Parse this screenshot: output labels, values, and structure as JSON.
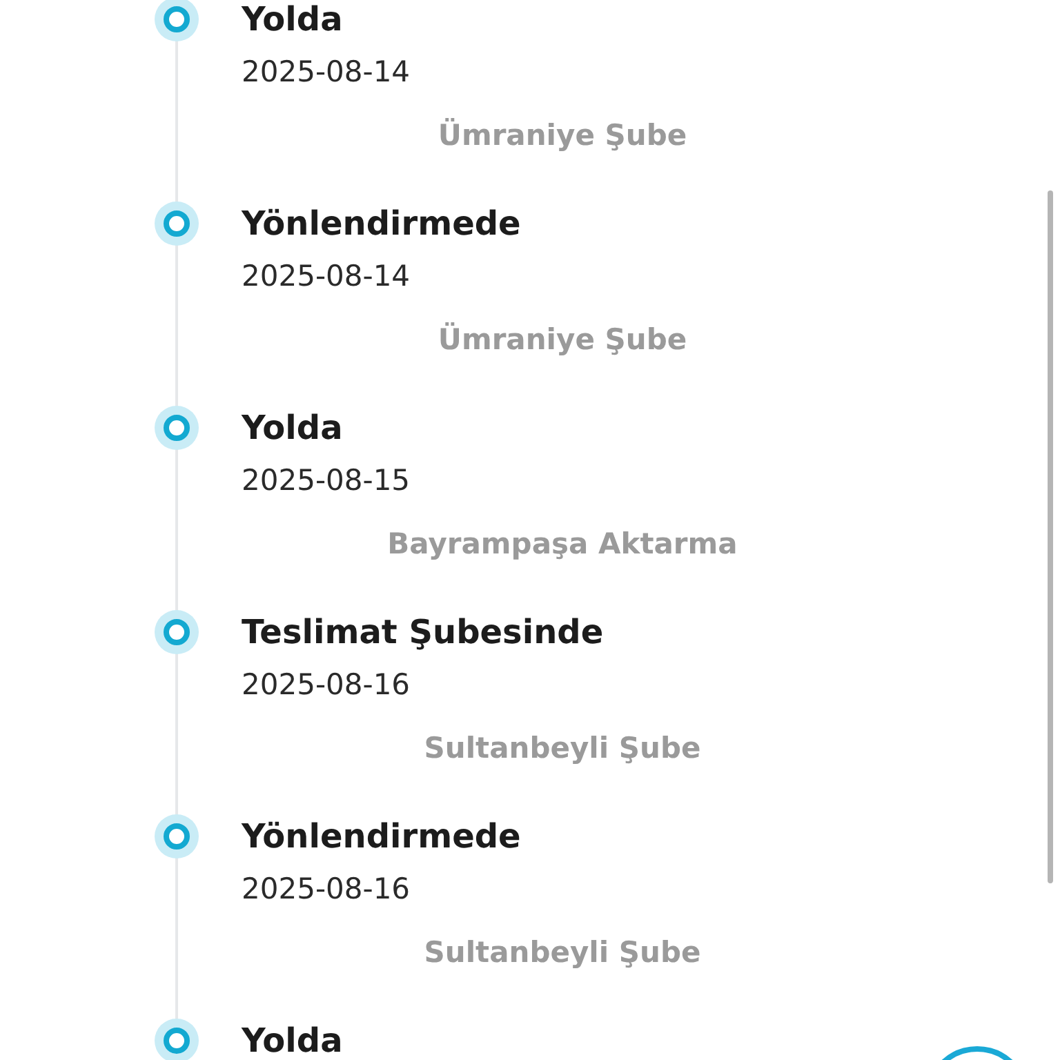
{
  "timeline": [
    {
      "status": "Yolda",
      "date": "2025-08-14",
      "location": "Ümraniye Şube"
    },
    {
      "status": "Yönlendirmede",
      "date": "2025-08-14",
      "location": "Ümraniye Şube"
    },
    {
      "status": "Yolda",
      "date": "2025-08-15",
      "location": "Bayrampaşa Aktarma"
    },
    {
      "status": "Teslimat Şubesinde",
      "date": "2025-08-16",
      "location": "Sultanbeyli Şube"
    },
    {
      "status": "Yönlendirmede",
      "date": "2025-08-16",
      "location": "Sultanbeyli Şube"
    },
    {
      "status": "Yolda"
    }
  ]
}
